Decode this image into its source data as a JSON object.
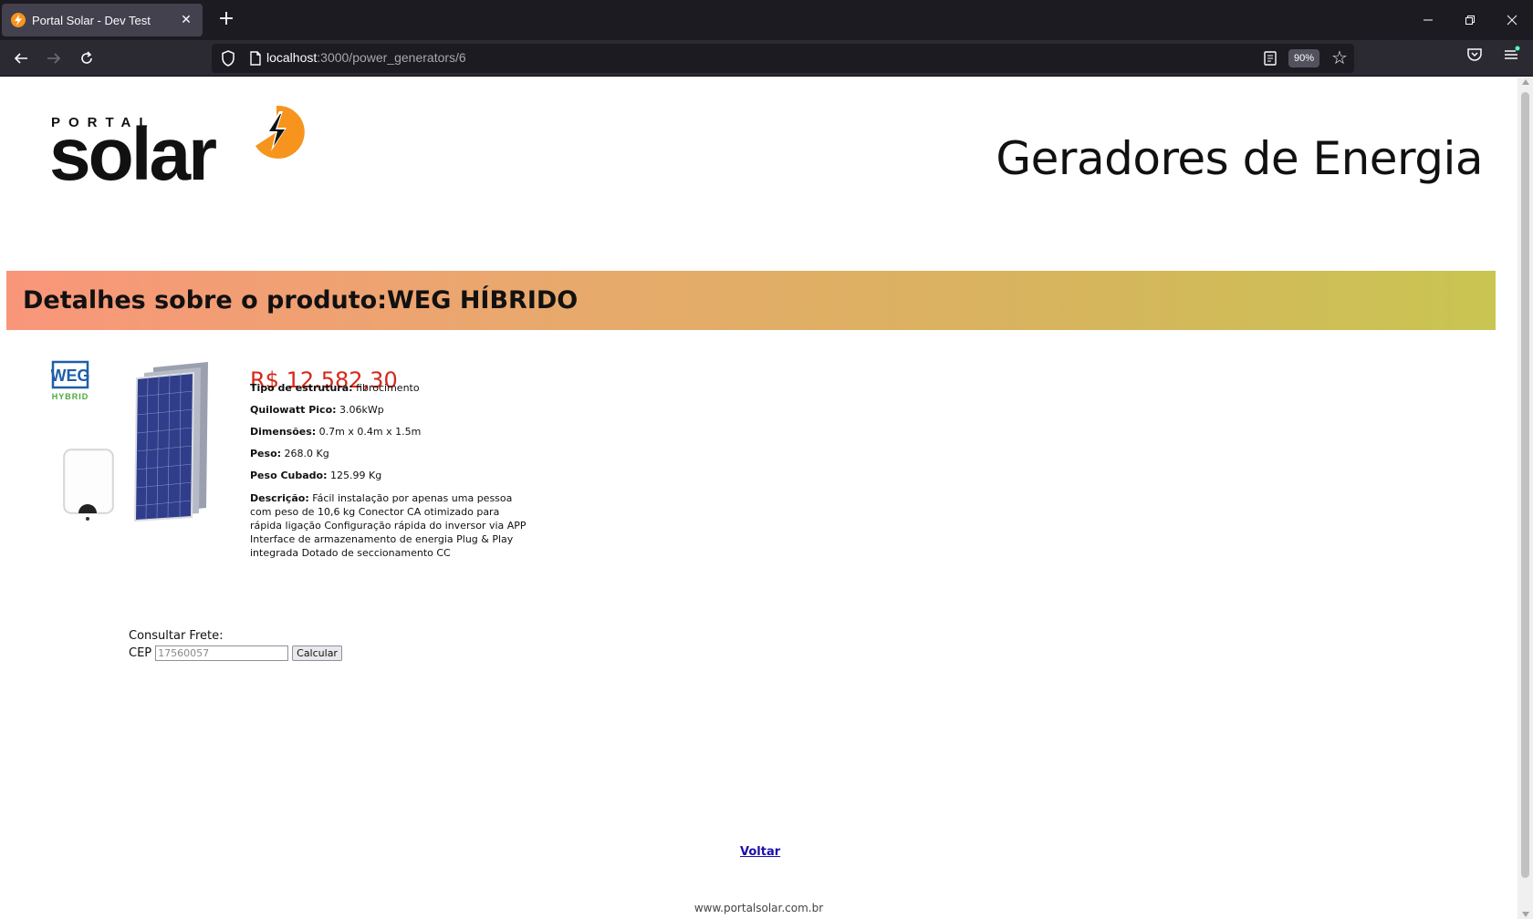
{
  "browser": {
    "tab_title": "Portal Solar - Dev Test",
    "url_host": "localhost",
    "url_path": ":3000/power_generators/6",
    "zoom": "90%"
  },
  "header": {
    "logo_portal": "PORTAL",
    "logo_solar": "solar",
    "title": "Geradores de Energia"
  },
  "product": {
    "banner_title": "Detalhes sobre o produto:WEG HÍBRIDO",
    "brand_logo_text": "WEG",
    "brand_tag": "HYBRID",
    "price": "R$ 12.582,30",
    "specs": [
      {
        "label": "Tipo de estrutura:",
        "value": "fibrocimento"
      },
      {
        "label": "Quilowatt Pico:",
        "value": "3.06kWp"
      },
      {
        "label": "Dimensões:",
        "value": "0.7m x 0.4m x 1.5m"
      },
      {
        "label": "Peso:",
        "value": "268.0 Kg"
      },
      {
        "label": "Peso Cubado:",
        "value": "125.99 Kg"
      }
    ],
    "description_label": "Descrição:",
    "description": "Fácil instalação por apenas uma pessoa com peso de 10,6 kg Conector CA otimizado para rápida ligação Configuração rápida do inversor via APP Interface de armazenamento de energia Plug & Play integrada Dotado de seccionamento CC"
  },
  "freight": {
    "title": "Consultar Frete:",
    "cep_label": "CEP",
    "cep_placeholder": "17560057",
    "button_label": "Calcular"
  },
  "links": {
    "back": "Voltar"
  },
  "footer": {
    "site": "www.portalsolar.com.br"
  },
  "colors": {
    "price": "#d5281b",
    "brand_orange": "#f7941d",
    "banner_start": "#f9967a",
    "banner_end": "#c9c552"
  }
}
